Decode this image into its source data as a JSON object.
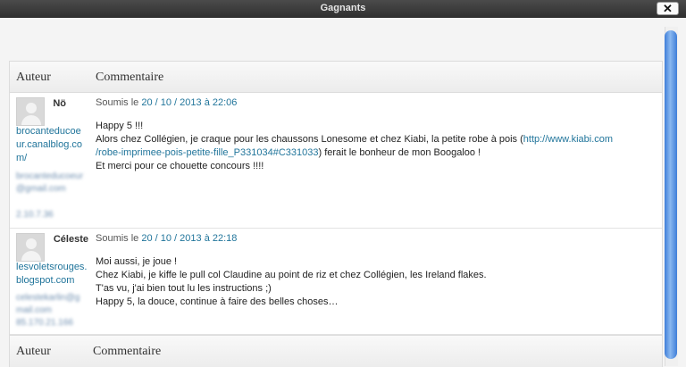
{
  "window": {
    "title": "Gagnants",
    "close_label": "✕"
  },
  "table": {
    "header": {
      "col_author": "Auteur",
      "col_comment": "Commentaire"
    },
    "footer": {
      "col_author": "Auteur",
      "col_comment": "Commentaire"
    }
  },
  "comments": [
    {
      "author": "Nö",
      "author_url": "brocanteducoeur.canalblog.com/",
      "author_email": "brocanteducoeur@gmail.com",
      "author_ip": "2.10.7.36",
      "submitted_prefix": "Soumis le",
      "date": "20 / 10 / 2013 à 22:06",
      "lines": [
        "Happy 5 !!!",
        "Alors chez Collégien, je craque pour les chaussons Lonesome et chez Kiabi, la petite robe à pois (",
        "http://www.kiabi.com",
        "/robe-imprimee-pois-petite-fille_P331034#C331033",
        ") ferait le bonheur de mon Boogaloo !",
        "Et merci pour ce chouette concours !!!!"
      ]
    },
    {
      "author": "Céleste",
      "author_url": "lesvoletsrouges.blogspot.com",
      "author_email": "celestekarlin@gmail.com",
      "author_ip": "85.170.21.166",
      "submitted_prefix": "Soumis le",
      "date": "20 / 10 / 2013 à 22:18",
      "lines": [
        "Moi aussi, je joue !",
        "Chez Kiabi, je kiffe le pull col Claudine au point de riz et chez Collégien, les Ireland flakes.",
        "T'as vu, j'ai bien tout lu les instructions ;)",
        "Happy 5, la douce, continue à faire des belles choses…"
      ]
    }
  ]
}
